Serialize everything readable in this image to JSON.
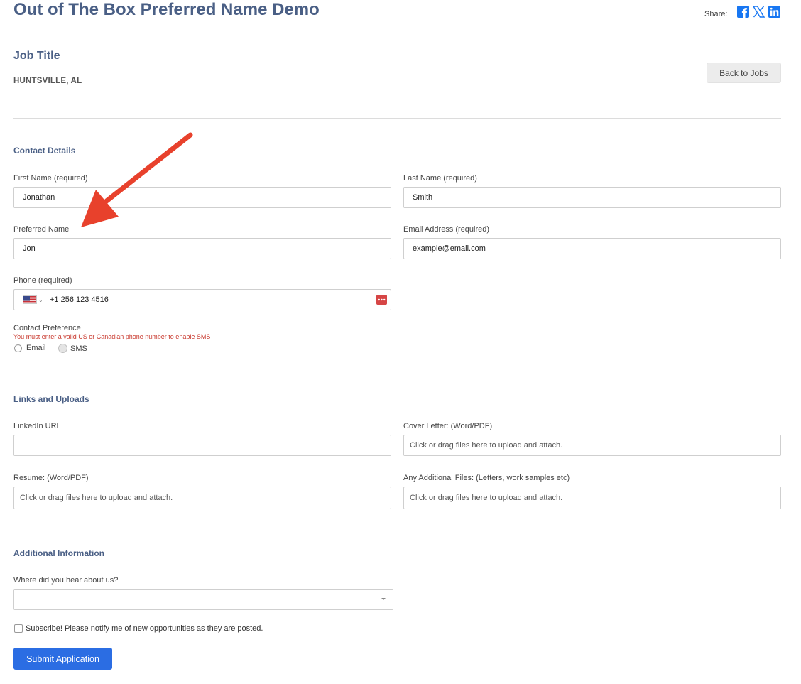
{
  "header": {
    "title": "Out of The Box Preferred Name Demo",
    "share_label": "Share:",
    "share_icons": [
      "facebook-icon",
      "x-icon",
      "linkedin-icon"
    ],
    "brand_color": "#1877f2"
  },
  "job": {
    "title": "Job Title",
    "location": "HUNTSVILLE, AL",
    "back_label": "Back to Jobs"
  },
  "contact": {
    "section_title": "Contact Details",
    "first_name_label": "First Name (required)",
    "first_name_value": "Jonathan",
    "last_name_label": "Last Name (required)",
    "last_name_value": "Smith",
    "preferred_name_label": "Preferred Name",
    "preferred_name_value": "Jon",
    "email_label": "Email Address (required)",
    "email_value": "example@email.com",
    "phone_label": "Phone (required)",
    "phone_value": "+1 256 123 4516",
    "phone_country": "US",
    "preference_label": "Contact Preference",
    "preference_error": "You must enter a valid US or Canadian phone number to enable SMS",
    "option_email": "Email",
    "option_sms": "SMS"
  },
  "links": {
    "section_title": "Links and Uploads",
    "linkedin_label": "LinkedIn URL",
    "linkedin_value": "",
    "cover_label": "Cover Letter: (Word/PDF)",
    "cover_placeholder": "Click or drag files here to upload and attach.",
    "resume_label": "Resume: (Word/PDF)",
    "resume_placeholder": "Click or drag files here to upload and attach.",
    "additional_label": "Any Additional Files: (Letters, work samples etc)",
    "additional_placeholder": "Click or drag files here to upload and attach."
  },
  "additional": {
    "section_title": "Additional Information",
    "source_label": "Where did you hear about us?",
    "source_value": "",
    "subscribe_label": "Subscribe! Please notify me of new opportunities as they are posted."
  },
  "submit_label": "Submit Application",
  "annotation": {
    "color": "#e8412c"
  }
}
